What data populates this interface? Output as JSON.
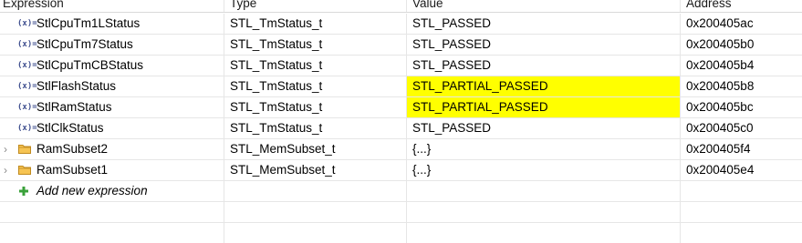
{
  "columns": [
    "Expression",
    "Type",
    "Value",
    "Address"
  ],
  "rows": [
    {
      "name": "StlCpuTm1LStatus",
      "type": "STL_TmStatus_t",
      "value": "STL_PASSED",
      "address": "0x200405ac"
    },
    {
      "name": "StlCpuTm7Status",
      "type": "STL_TmStatus_t",
      "value": "STL_PASSED",
      "address": "0x200405b0"
    },
    {
      "name": "StlCpuTmCBStatus",
      "type": "STL_TmStatus_t",
      "value": "STL_PASSED",
      "address": "0x200405b4"
    },
    {
      "name": "StlFlashStatus",
      "type": "STL_TmStatus_t",
      "value": "STL_PARTIAL_PASSED",
      "address": "0x200405b8"
    },
    {
      "name": "StlRamStatus",
      "type": "STL_TmStatus_t",
      "value": "STL_PARTIAL_PASSED",
      "address": "0x200405bc"
    },
    {
      "name": "StlClkStatus",
      "type": "STL_TmStatus_t",
      "value": "STL_PASSED",
      "address": "0x200405c0"
    },
    {
      "name": "RamSubset2",
      "type": "STL_MemSubset_t",
      "value": "{...}",
      "address": "0x200405f4"
    },
    {
      "name": "RamSubset1",
      "type": "STL_MemSubset_t",
      "value": "{...}",
      "address": "0x200405e4"
    }
  ],
  "add_expression": "Add new expression",
  "icons": {
    "variable": "(x)=",
    "struct": "folder-icon",
    "expand": "›",
    "add": "plus-icon"
  },
  "colors": {
    "highlight": "#ffff00",
    "grid": "#e6e6e6",
    "plus": "#3aa13a",
    "folder": "#e3a52b"
  }
}
